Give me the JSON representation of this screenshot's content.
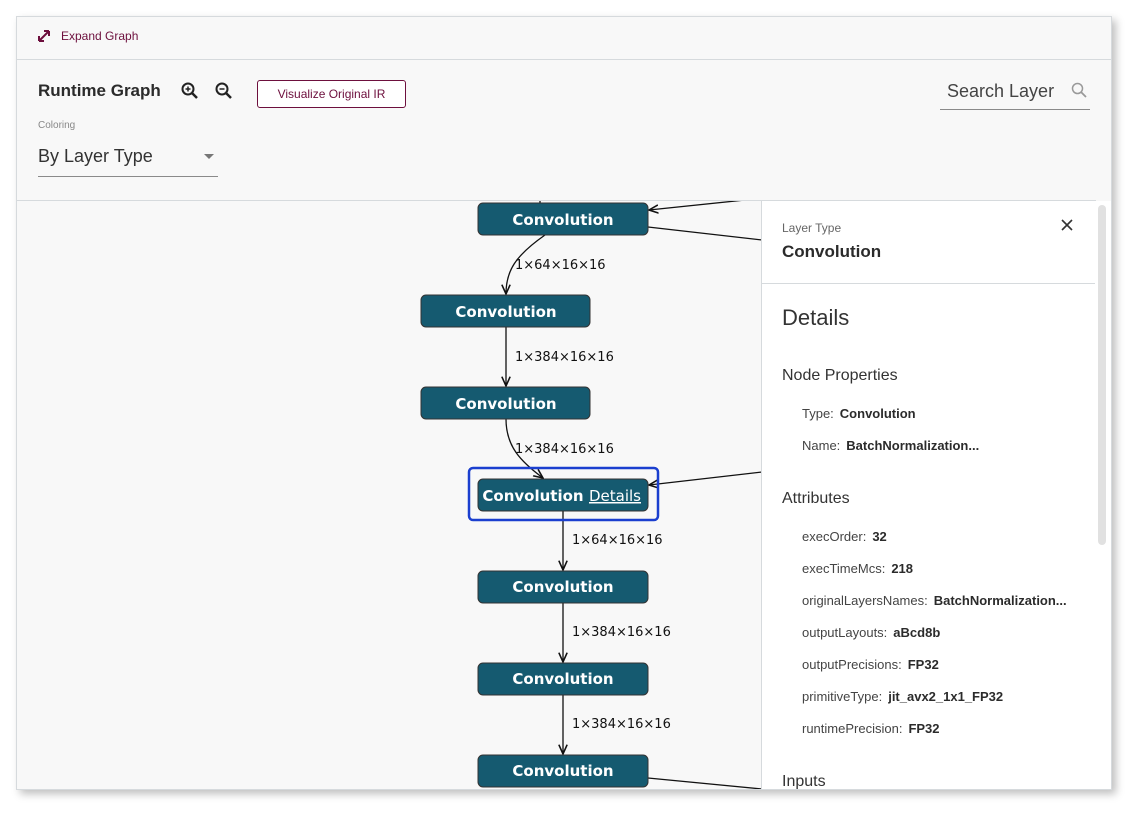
{
  "header": {
    "expand_label": "Expand Graph"
  },
  "toolbar": {
    "title": "Runtime Graph",
    "visualize_label": "Visualize Original IR",
    "coloring_label": "Coloring",
    "coloring_value": "By Layer Type",
    "search_placeholder": "Search Layer"
  },
  "graph": {
    "node_color": "#155a70",
    "selected_color": "#1b3fcf",
    "nodes": [
      {
        "label": "Convolution"
      },
      {
        "label": "Convolution"
      },
      {
        "label": "Convolution"
      },
      {
        "label": "Convolution",
        "details_link": "Details",
        "selected": true
      },
      {
        "label": "Convolution"
      },
      {
        "label": "Convolution"
      },
      {
        "label": "Convolution"
      }
    ],
    "edges": [
      {
        "label": "1×64×16×16"
      },
      {
        "label": "1×384×16×16"
      },
      {
        "label": "1×384×16×16"
      },
      {
        "label": "1×64×16×16"
      },
      {
        "label": "1×384×16×16"
      },
      {
        "label": "1×384×16×16"
      }
    ]
  },
  "panel": {
    "layer_type_label": "Layer Type",
    "layer_type_value": "Convolution",
    "details_title": "Details",
    "node_properties_title": "Node Properties",
    "node_properties": [
      {
        "key": "Type:",
        "value": "Convolution"
      },
      {
        "key": "Name:",
        "value": "BatchNormalization..."
      }
    ],
    "attributes_title": "Attributes",
    "attributes": [
      {
        "key": "execOrder:",
        "value": "32"
      },
      {
        "key": "execTimeMcs:",
        "value": "218"
      },
      {
        "key": "originalLayersNames:",
        "value": "BatchNormalization..."
      },
      {
        "key": "outputLayouts:",
        "value": "aBcd8b"
      },
      {
        "key": "outputPrecisions:",
        "value": "FP32"
      },
      {
        "key": "primitiveType:",
        "value": "jit_avx2_1x1_FP32"
      },
      {
        "key": "runtimePrecision:",
        "value": "FP32"
      }
    ],
    "inputs_title": "Inputs"
  }
}
